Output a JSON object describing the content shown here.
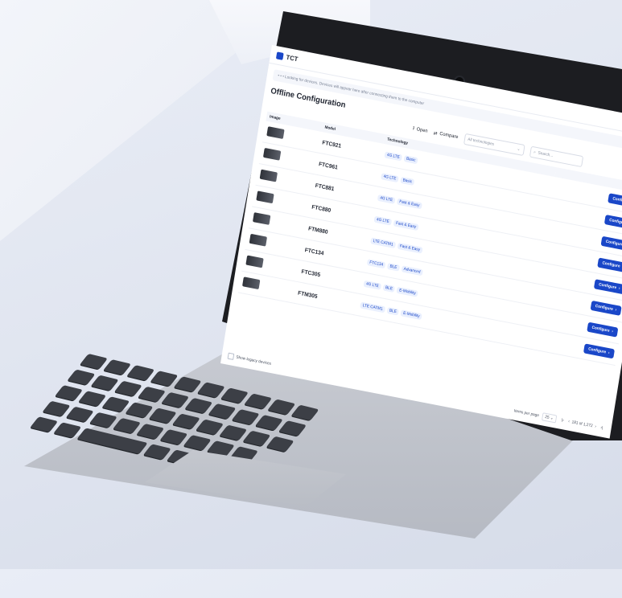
{
  "app": {
    "title": "TCT"
  },
  "status": {
    "text": "Looking for devices. Devices will appear here after connecting them to the computer"
  },
  "page": {
    "title": "Offline Configuration"
  },
  "toolbar": {
    "open_label": "Open",
    "compare_label": "Compare",
    "technology_filter": "All technologies",
    "search_placeholder": "Search..."
  },
  "table": {
    "headers": {
      "image": "Image",
      "model": "Model",
      "technology": "Technology"
    },
    "rows": [
      {
        "model": "FTC921",
        "tags": [
          "4G LTE",
          "Basic"
        ]
      },
      {
        "model": "FTC961",
        "tags": [
          "4G LTE",
          "Basic"
        ]
      },
      {
        "model": "FTC881",
        "tags": [
          "4G LTE",
          "Fast & Easy"
        ]
      },
      {
        "model": "FTC880",
        "tags": [
          "4G LTE",
          "Fast & Easy"
        ]
      },
      {
        "model": "FTM880",
        "tags": [
          "LTE CATM1",
          "Fast & Easy"
        ]
      },
      {
        "model": "FTC134",
        "tags": [
          "FTC134",
          "BLE",
          "Advanced"
        ]
      },
      {
        "model": "FTC305",
        "tags": [
          "4G LTE",
          "BLE",
          "E-Mobility"
        ]
      },
      {
        "model": "FTM305",
        "tags": [
          "LTE CATM1",
          "BLE",
          "E-Mobility"
        ]
      }
    ],
    "configure_label": "Configure"
  },
  "footer": {
    "legacy_label": "Show legacy devices",
    "items_per_page_label": "Items per page",
    "items_per_page": "25",
    "range": "181 of 1,272"
  },
  "colors": {
    "accent": "#1a47c8",
    "chip_bg": "#eaf0fe"
  }
}
